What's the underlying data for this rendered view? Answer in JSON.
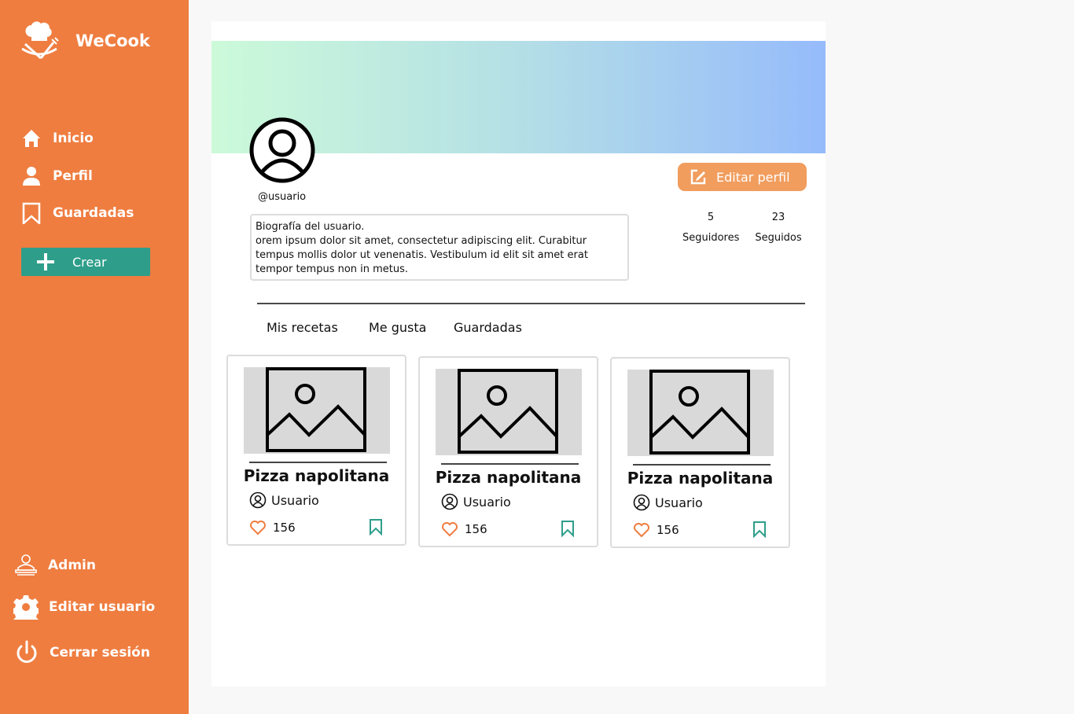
{
  "brand": {
    "name": "WeCook"
  },
  "nav": {
    "home": "Inicio",
    "profile": "Perfil",
    "saved": "Guardadas",
    "create": "Crear"
  },
  "bottom_nav": {
    "admin": "Admin",
    "edit_user": "Editar usuario",
    "logout": "Cerrar sesión"
  },
  "profile": {
    "handle": "@usuario",
    "bio_title": "Biografía del usuario.",
    "bio_text": "orem ipsum dolor sit amet, consectetur adipiscing elit. Curabitur tempus mollis dolor ut venenatis. Vestibulum id elit sit amet erat tempor tempus non in metus.",
    "edit_button": "Editar perfil",
    "followers_count": "5",
    "followers_label": "Seguidores",
    "following_count": "23",
    "following_label": "Seguidos"
  },
  "tabs": [
    "Mis recetas",
    "Me gusta",
    "Guardadas"
  ],
  "recipes": [
    {
      "title": "Pizza napolitana",
      "author": "Usuario",
      "likes": "156"
    },
    {
      "title": "Pizza napolitana",
      "author": "Usuario",
      "likes": "156"
    },
    {
      "title": "Pizza napolitana",
      "author": "Usuario",
      "likes": "156"
    }
  ],
  "colors": {
    "sidebar": "#ef7d40",
    "create_button": "#2e9e8a",
    "edit_button": "#f19d5e",
    "like_icon": "#ef7d40",
    "save_icon": "#2e9e8a"
  },
  "icons": {
    "brand": "chef-hat-utensils-icon",
    "home": "home-icon",
    "profile": "user-icon",
    "saved": "bookmark-icon",
    "create": "plus-icon",
    "admin": "chef-admin-icon",
    "edit_user": "gear-icon",
    "logout": "power-icon",
    "edit_profile": "edit-icon",
    "recipe_image": "image-placeholder-icon",
    "author": "user-circle-icon",
    "like": "heart-icon",
    "save": "bookmark-icon"
  }
}
